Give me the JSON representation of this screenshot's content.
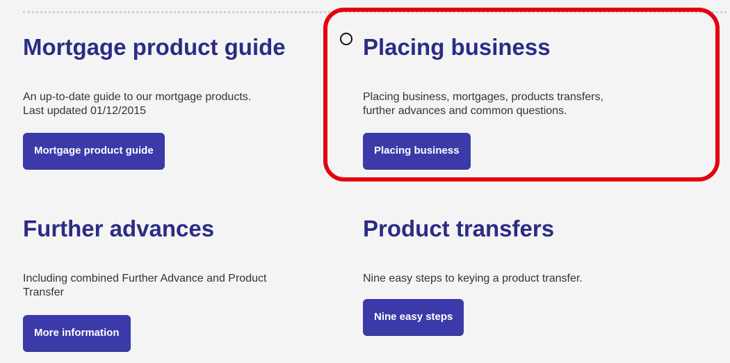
{
  "cards": [
    {
      "title": "Mortgage product guide",
      "description_line1": "An up-to-date guide to our mortgage products.",
      "description_line2": "Last updated 01/12/2015",
      "button_label": "Mortgage product guide"
    },
    {
      "title": "Placing business",
      "description_line1": "Placing business, mortgages, products transfers,",
      "description_line2": "further advances and common questions.",
      "button_label": "Placing business"
    },
    {
      "title": "Further advances",
      "description_line1": "Including combined Further Advance and Product",
      "description_line2": "Transfer",
      "button_label": "More information"
    },
    {
      "title": "Product transfers",
      "description_line1": "Nine easy steps to keying a product transfer.",
      "description_line2": "",
      "button_label": "Nine easy steps"
    }
  ],
  "colors": {
    "title": "#2b2c85",
    "button": "#3b3aa8",
    "highlight": "#e3000f",
    "background": "#f4f4f4"
  },
  "icons": {
    "cursor": "cursor-ring-icon"
  }
}
